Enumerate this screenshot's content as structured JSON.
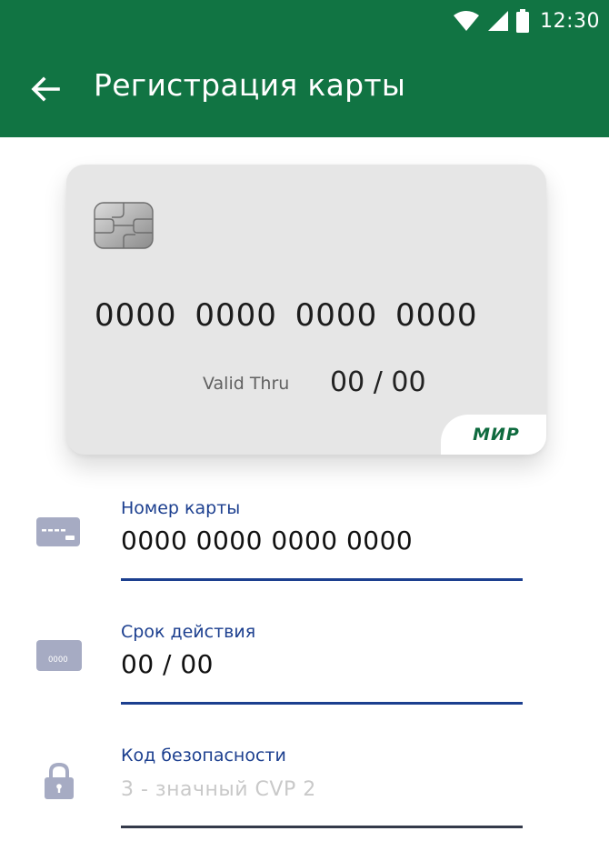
{
  "status_bar": {
    "time": "12:30",
    "icons": [
      "wifi-icon",
      "signal-icon",
      "battery-icon"
    ]
  },
  "app_bar": {
    "back_icon": "arrow-left-icon",
    "title": "Регистрация карты"
  },
  "card_preview": {
    "number": "0000 0000 0000 0000",
    "valid_label": "Valid Thru",
    "valid_value": "00 / 00",
    "brand": "МИР"
  },
  "form": {
    "card_number": {
      "label": "Номер карты",
      "value": "0000 0000 0000 0000",
      "icon": "credit-card-icon"
    },
    "expiry": {
      "label": "Срок действия",
      "value": "00 / 00",
      "icon": "card-expiry-icon",
      "icon_text": "0000"
    },
    "security_code": {
      "label": "Код безопасности",
      "placeholder": "3 - значный CVP 2",
      "icon": "lock-icon"
    }
  },
  "colors": {
    "app_bar": "#117443",
    "accent": "#1c3f8f",
    "brand": "#0f6b3f",
    "icon": "#a6abc3",
    "card_bg": "#e6e6e6"
  }
}
